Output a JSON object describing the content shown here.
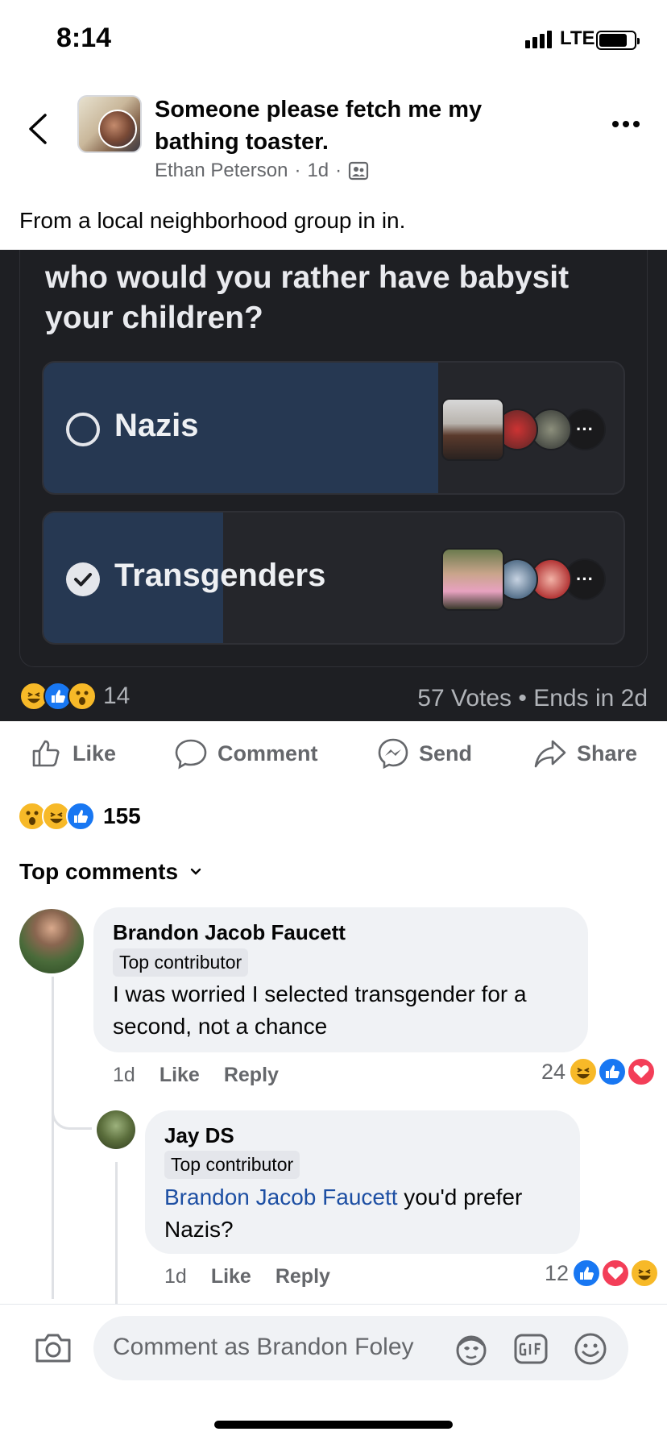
{
  "status_bar": {
    "time": "8:14",
    "network": "LTE"
  },
  "header": {
    "title": "Someone please fetch me my bathing toaster.",
    "author": "Ethan Peterson",
    "sep1": "·",
    "time": "1d",
    "sep2": "·",
    "privacy_icon": "group-members-icon"
  },
  "post": {
    "text": "From a local neighborhood group in in."
  },
  "poll": {
    "question": "who would you rather have babysit your children?",
    "options": [
      {
        "label": "Nazis",
        "selected": false,
        "fill_fraction": 0.68,
        "more": "···"
      },
      {
        "label": "Transgenders",
        "selected": true,
        "fill_fraction": 0.31,
        "more": "···"
      }
    ],
    "reaction_count": "14",
    "votes_text": "57 Votes • Ends in 2d"
  },
  "actions": {
    "like": "Like",
    "comment": "Comment",
    "send": "Send",
    "share": "Share"
  },
  "reactions": {
    "count": "155"
  },
  "comments_section": {
    "label": "Top comments"
  },
  "comments": [
    {
      "author": "Brandon Jacob Faucett",
      "badge": "Top contributor",
      "text": "I was worried I selected transgender for a second, not a chance",
      "time": "1d",
      "like": "Like",
      "reply": "Reply",
      "reaction_count": "24"
    },
    {
      "author": "Jay DS",
      "badge": "Top contributor",
      "mention": "Brandon Jacob Faucett",
      "text": " you'd prefer Nazis?",
      "time": "1d",
      "like": "Like",
      "reply": "Reply",
      "reaction_count": "12"
    }
  ],
  "composer": {
    "placeholder": "Comment as Brandon Foley"
  },
  "colors": {
    "accent": "#1877f2",
    "poll_bg": "#1e1f23",
    "poll_fill": "#263852",
    "mention": "#1d4fa3"
  }
}
